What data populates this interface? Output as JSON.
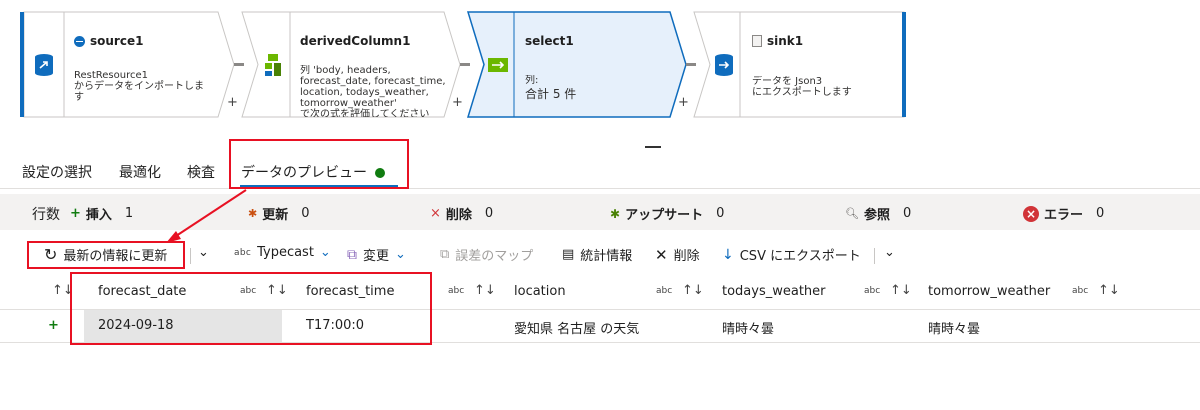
{
  "pipeline": {
    "nodes": [
      {
        "id": "source1",
        "title": "source1",
        "desc": "RestResource1\nからデータをインポートしま\nす",
        "icon": "source-icon"
      },
      {
        "id": "derivedColumn1",
        "title": "derivedColumn1",
        "desc": "列 'body, headers,\nforecast_date, forecast_time,\nlocation, todays_weather,\ntomorrow_weather'\nで次の式を評価してください",
        "icon": "derived-column-icon"
      },
      {
        "id": "select1",
        "title": "select1",
        "desc_label": "列:",
        "desc_value": "合計 5 件",
        "icon": "select-icon"
      },
      {
        "id": "sink1",
        "title": "sink1",
        "desc": "データを Json3\nにエクスポートします",
        "icon": "sink-icon"
      }
    ],
    "plus_label": "+"
  },
  "tabs": [
    "設定の選択",
    "最適化",
    "検査",
    "データのプレビュー"
  ],
  "stats": {
    "rows_label": "行数",
    "insert": {
      "label": "挿入",
      "value": "1"
    },
    "update": {
      "label": "更新",
      "value": "0"
    },
    "delete": {
      "label": "削除",
      "value": "0"
    },
    "upsert": {
      "label": "アップサート",
      "value": "0"
    },
    "lookup": {
      "label": "参照",
      "value": "0"
    },
    "error": {
      "label": "エラー",
      "value": "0"
    }
  },
  "toolbar": {
    "refresh": "最新の情報に更新",
    "typecast": "Typecast",
    "typecast_abc": "abc",
    "modify": "変更",
    "error_map": "誤差のマップ",
    "statistics": "統計情報",
    "delete": "削除",
    "export_csv": "CSV にエクスポート"
  },
  "grid": {
    "type_label": "abc",
    "columns": [
      "forecast_date",
      "forecast_time",
      "location",
      "todays_weather",
      "tomorrow_weather"
    ],
    "rows": [
      {
        "marker": "+",
        "cells": [
          "2024-09-18",
          "T17:00:0",
          "愛知県 名古屋 の天気",
          "晴時々曇",
          "晴時々曇"
        ]
      }
    ]
  },
  "colors": {
    "accent": "#0f6cbd",
    "selected_node_bg": "#e6f0fb",
    "annotation_red": "#e81123",
    "status_green": "#107c10",
    "error_red": "#d13438"
  }
}
